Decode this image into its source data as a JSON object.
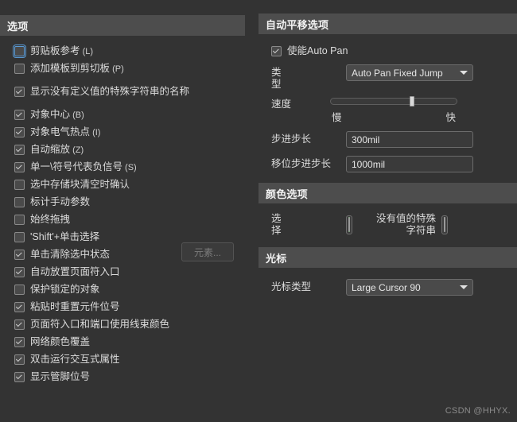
{
  "left_panel": {
    "title": "选项",
    "options": [
      {
        "label": "剪贴板参考",
        "mnemonic": "(L)",
        "checked": false,
        "focused": true,
        "gap": "none"
      },
      {
        "label": "添加模板到剪切板",
        "mnemonic": "(P)",
        "checked": false,
        "focused": false,
        "gap": "none"
      },
      {
        "label": "显示没有定义值的特殊字符串的名称",
        "mnemonic": "",
        "checked": true,
        "focused": false,
        "gap": "top"
      },
      {
        "label": "对象中心",
        "mnemonic": "(B)",
        "checked": true,
        "focused": false,
        "gap": "top"
      },
      {
        "label": "对象电气热点",
        "mnemonic": "(I)",
        "checked": true,
        "focused": false,
        "gap": "none"
      },
      {
        "label": "自动缩放",
        "mnemonic": "(Z)",
        "checked": true,
        "focused": false,
        "gap": "none"
      },
      {
        "label": "单一\\符号代表负信号",
        "mnemonic": "(S)",
        "checked": true,
        "focused": false,
        "gap": "none"
      },
      {
        "label": "选中存储块清空时确认",
        "mnemonic": "",
        "checked": false,
        "focused": false,
        "gap": "none"
      },
      {
        "label": "标计手动参数",
        "mnemonic": "",
        "checked": false,
        "focused": false,
        "gap": "none"
      },
      {
        "label": "始终拖拽",
        "mnemonic": "",
        "checked": false,
        "focused": false,
        "gap": "none"
      },
      {
        "label": "'Shift'+单击选择",
        "mnemonic": "",
        "checked": false,
        "focused": false,
        "gap": "none"
      },
      {
        "label": "单击清除选中状态",
        "mnemonic": "",
        "checked": true,
        "focused": false,
        "gap": "none"
      },
      {
        "label": "自动放置页面符入口",
        "mnemonic": "",
        "checked": true,
        "focused": false,
        "gap": "none"
      },
      {
        "label": "保护锁定的对象",
        "mnemonic": "",
        "checked": false,
        "focused": false,
        "gap": "none"
      },
      {
        "label": "粘贴时重置元件位号",
        "mnemonic": "",
        "checked": true,
        "focused": false,
        "gap": "none"
      },
      {
        "label": "页面符入口和端口使用线束颜色",
        "mnemonic": "",
        "checked": true,
        "focused": false,
        "gap": "none"
      },
      {
        "label": "网络颜色覆盖",
        "mnemonic": "",
        "checked": true,
        "focused": false,
        "gap": "none"
      },
      {
        "label": "双击运行交互式属性",
        "mnemonic": "",
        "checked": true,
        "focused": false,
        "gap": "none"
      },
      {
        "label": "显示管脚位号",
        "mnemonic": "",
        "checked": true,
        "focused": false,
        "gap": "none"
      }
    ],
    "elements_button": "元素..."
  },
  "auto_pan": {
    "title": "自动平移选项",
    "enable_label": "使能Auto Pan",
    "enable_checked": true,
    "type_label": "类型",
    "type_value": "Auto Pan Fixed Jump",
    "speed_label": "速度",
    "speed_slow": "慢",
    "speed_fast": "快",
    "step_label": "步进步长",
    "step_value": "300mil",
    "shift_step_label": "移位步进步长",
    "shift_step_value": "1000mil"
  },
  "colors": {
    "title": "颜色选项",
    "selection_label": "选择",
    "selection_color": "#00E000",
    "novalue_label": "没有值的特殊\n字符串",
    "novalue_color": "#808080"
  },
  "cursor": {
    "title": "光标",
    "type_label": "光标类型",
    "type_value": "Large Cursor 90"
  },
  "watermark": "CSDN @HHYX."
}
